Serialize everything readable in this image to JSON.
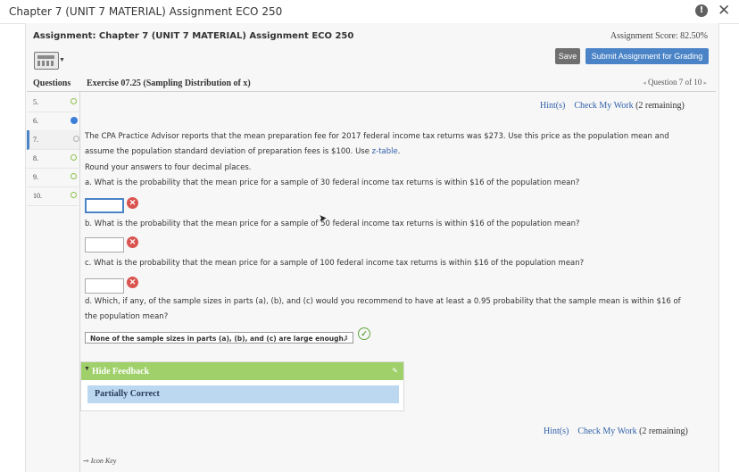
{
  "window": {
    "title": "Chapter 7 (UNIT 7 MATERIAL) Assignment ECO 250",
    "info_icon": "info-icon",
    "close_glyph": "✕"
  },
  "assignment": {
    "title": "Assignment: Chapter 7 (UNIT 7 MATERIAL) Assignment ECO 250",
    "score": "Assignment Score: 82.50%"
  },
  "toolbar": {
    "save_label": "Save",
    "submit_label": "Submit Assignment for Grading"
  },
  "questions_header": "Questions",
  "exercise_title": "Exercise 07.25 (Sampling Distribution of x)",
  "question_nav": {
    "prev": "◂",
    "label": "Question 7 of 10",
    "next": "▸"
  },
  "questions": [
    {
      "num": "5.",
      "status": "complete"
    },
    {
      "num": "6.",
      "status": "current"
    },
    {
      "num": "7.",
      "status": "partial"
    },
    {
      "num": "8.",
      "status": "complete"
    },
    {
      "num": "9.",
      "status": "complete"
    },
    {
      "num": "10.",
      "status": "complete"
    }
  ],
  "hints": {
    "hint_label": "Hint(s)",
    "check_label": "Check My Work",
    "remaining": "(2 remaining)"
  },
  "problem": {
    "line1": "The CPA Practice Advisor reports that the mean preparation fee for 2017 federal income tax returns was $273. Use this price as the population mean and",
    "line2_pre": "assume the population standard deviation of preparation fees is $100. Use ",
    "ztable": "z-table",
    "line2_post": ".",
    "round_note": "Round your answers to four decimal places.",
    "qa": "a. What is the probability that the mean price for a sample of 30 federal income tax returns is within $16 of the population mean?",
    "qb": "b. What is the probability that the mean price for a sample of 50 federal income tax returns is within $16 of the population mean?",
    "qc": "c. What is the probability that the mean price for a sample of 100 federal income tax returns is within $16 of the population mean?",
    "qd1": "d. Which, if any, of the sample sizes in parts (a), (b), and (c) would you recommend to have at least a 0.95 probability that the sample mean is within $16 of",
    "qd2": "the population mean?",
    "select_value": "None of the sample sizes in parts (a), (b), and (c) are large enough."
  },
  "feedback": {
    "toggle_label": "Hide Feedback",
    "result": "Partially Correct"
  },
  "icon_key": "Icon Key",
  "colors": {
    "accent": "#4a84c7",
    "correct": "#5da53f",
    "incorrect": "#d9534f",
    "feedback_header": "#9fd06a",
    "feedback_body": "#bcd8f0"
  }
}
